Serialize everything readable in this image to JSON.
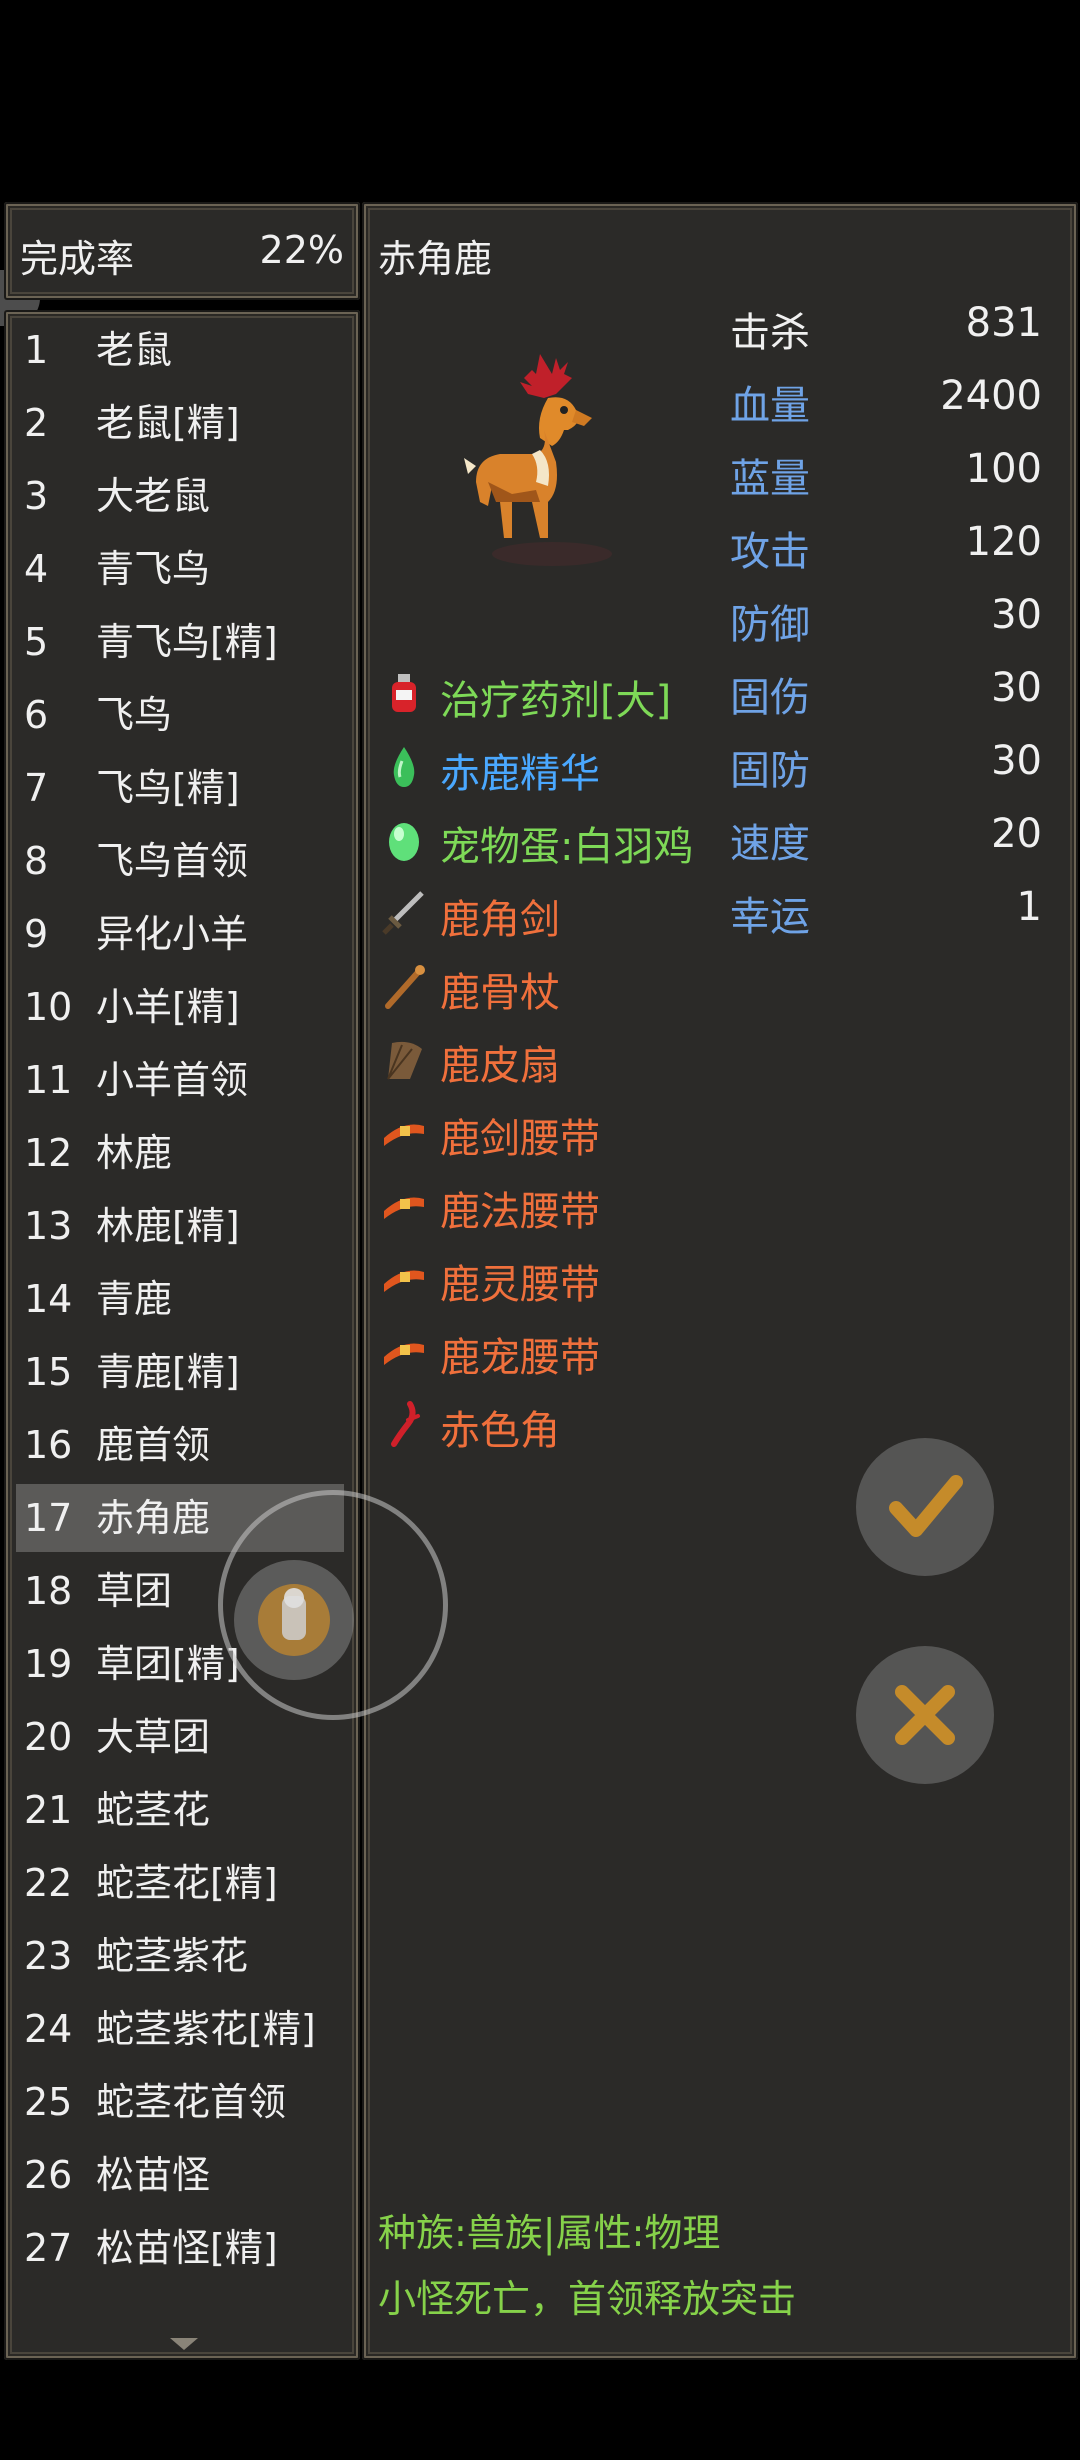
{
  "completion": {
    "label": "完成率",
    "value": "22%"
  },
  "list": [
    {
      "num": "1",
      "name": "老鼠"
    },
    {
      "num": "2",
      "name": "老鼠[精]"
    },
    {
      "num": "3",
      "name": "大老鼠"
    },
    {
      "num": "4",
      "name": "青飞鸟"
    },
    {
      "num": "5",
      "name": "青飞鸟[精]"
    },
    {
      "num": "6",
      "name": "飞鸟"
    },
    {
      "num": "7",
      "name": "飞鸟[精]"
    },
    {
      "num": "8",
      "name": "飞鸟首领"
    },
    {
      "num": "9",
      "name": "异化小羊"
    },
    {
      "num": "10",
      "name": "小羊[精]"
    },
    {
      "num": "11",
      "name": "小羊首领"
    },
    {
      "num": "12",
      "name": "林鹿"
    },
    {
      "num": "13",
      "name": "林鹿[精]"
    },
    {
      "num": "14",
      "name": "青鹿"
    },
    {
      "num": "15",
      "name": "青鹿[精]"
    },
    {
      "num": "16",
      "name": "鹿首领"
    },
    {
      "num": "17",
      "name": "赤角鹿"
    },
    {
      "num": "18",
      "name": "草团"
    },
    {
      "num": "19",
      "name": "草团[精]"
    },
    {
      "num": "20",
      "name": "大草团"
    },
    {
      "num": "21",
      "name": "蛇茎花"
    },
    {
      "num": "22",
      "name": "蛇茎花[精]"
    },
    {
      "num": "23",
      "name": "蛇茎紫花"
    },
    {
      "num": "24",
      "name": "蛇茎紫花[精]"
    },
    {
      "num": "25",
      "name": "蛇茎花首领"
    },
    {
      "num": "26",
      "name": "松苗怪"
    },
    {
      "num": "27",
      "name": "松苗怪[精]"
    }
  ],
  "selected_index": 16,
  "detail": {
    "title": "赤角鹿",
    "stats": [
      {
        "label": "击杀",
        "value": "831",
        "color": "#f0f0f0"
      },
      {
        "label": "血量",
        "value": "2400",
        "color": "#6fa3e6"
      },
      {
        "label": "蓝量",
        "value": "100",
        "color": "#6fa3e6"
      },
      {
        "label": "攻击",
        "value": "120",
        "color": "#6fa3e6"
      },
      {
        "label": "防御",
        "value": "30",
        "color": "#6fa3e6"
      },
      {
        "label": "固伤",
        "value": "30",
        "color": "#6fa3e6"
      },
      {
        "label": "固防",
        "value": "30",
        "color": "#6fa3e6"
      },
      {
        "label": "速度",
        "value": "20",
        "color": "#6fa3e6"
      },
      {
        "label": "幸运",
        "value": "1",
        "color": "#6fa3e6"
      }
    ],
    "drops": [
      {
        "name": "治疗药剂[大]",
        "color": "#7ed957",
        "icon": "potion-icon"
      },
      {
        "name": "赤鹿精华",
        "color": "#4aa8ff",
        "icon": "essence-drop-icon"
      },
      {
        "name": "宠物蛋:白羽鸡",
        "color": "#7ed957",
        "icon": "pet-egg-icon"
      },
      {
        "name": "鹿角剑",
        "color": "#f0703c",
        "icon": "sword-icon"
      },
      {
        "name": "鹿骨杖",
        "color": "#f0703c",
        "icon": "staff-icon"
      },
      {
        "name": "鹿皮扇",
        "color": "#f0703c",
        "icon": "fan-icon"
      },
      {
        "name": "鹿剑腰带",
        "color": "#f0703c",
        "icon": "belt-icon"
      },
      {
        "name": "鹿法腰带",
        "color": "#f0703c",
        "icon": "belt-icon"
      },
      {
        "name": "鹿灵腰带",
        "color": "#f0703c",
        "icon": "belt-icon"
      },
      {
        "name": "鹿宠腰带",
        "color": "#f0703c",
        "icon": "belt-icon"
      },
      {
        "name": "赤色角",
        "color": "#f0703c",
        "icon": "red-horn-icon"
      }
    ],
    "footer": {
      "race_attr": "种族:兽族|属性:物理",
      "skill": "小怪死亡，首领释放突击"
    }
  }
}
